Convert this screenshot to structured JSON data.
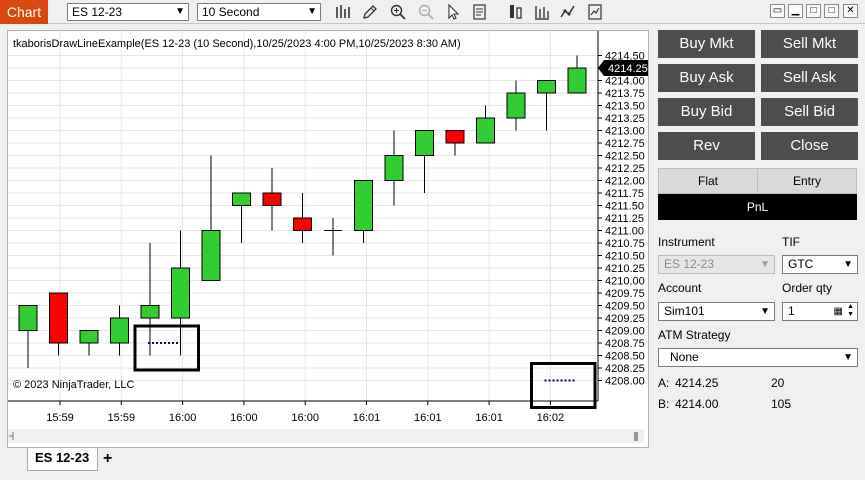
{
  "app": {
    "tag": "Chart"
  },
  "toolbar": {
    "instrument": "ES 12-23",
    "interval": "10 Second",
    "icons": [
      "bar-type-icon",
      "draw-pencil-icon",
      "zoom-in-icon",
      "zoom-out-icon",
      "pointer-icon",
      "properties-icon",
      "chart-trader-icon",
      "data-box-icon",
      "indicators-icon",
      "strategies-icon"
    ]
  },
  "window_controls": [
    "restore-icon",
    "minimize-icon",
    "maximize-icon",
    "close-icon"
  ],
  "chart": {
    "title": "tkaborisDrawLineExample(ES 12-23 (10 Second),10/25/2023 4:00 PM,10/25/2023 8:30 AM)",
    "copyright": "© 2023 NinjaTrader, LLC",
    "last_price_label": "4214.25",
    "colors": {
      "up": "#32cd32",
      "down": "#ff0000",
      "grid": "#e6e6e6",
      "marker": "#000080",
      "price_badge": "#000000"
    }
  },
  "chart_data": {
    "type": "candlestick",
    "y_ticks": [
      "4214.50",
      "4214.25",
      "4214.00",
      "4213.75",
      "4213.50",
      "4213.25",
      "4213.00",
      "4212.75",
      "4212.50",
      "4212.25",
      "4212.00",
      "4211.75",
      "4211.50",
      "4211.25",
      "4211.00",
      "4210.75",
      "4210.50",
      "4210.25",
      "4210.00",
      "4209.75",
      "4209.50",
      "4209.25",
      "4209.00",
      "4208.75",
      "4208.50",
      "4208.25",
      "4208.00"
    ],
    "ylim": [
      4207.75,
      4214.75
    ],
    "x_ticks": [
      "15:59",
      "15:59",
      "16:00",
      "16:00",
      "16:00",
      "16:01",
      "16:01",
      "16:01",
      "16:02"
    ],
    "candles": [
      {
        "o": 4209.0,
        "h": 4209.5,
        "l": 4208.25,
        "c": 4209.5
      },
      {
        "o": 4209.75,
        "h": 4209.75,
        "l": 4208.5,
        "c": 4208.75
      },
      {
        "o": 4208.75,
        "h": 4209.0,
        "l": 4208.5,
        "c": 4209.0
      },
      {
        "o": 4208.75,
        "h": 4209.5,
        "l": 4208.5,
        "c": 4209.25
      },
      {
        "o": 4209.25,
        "h": 4210.75,
        "l": 4208.5,
        "c": 4209.5
      },
      {
        "o": 4209.25,
        "h": 4211.0,
        "l": 4208.5,
        "c": 4210.25
      },
      {
        "o": 4210.0,
        "h": 4212.5,
        "l": 4210.0,
        "c": 4211.0
      },
      {
        "o": 4211.5,
        "h": 4211.75,
        "l": 4210.75,
        "c": 4211.75
      },
      {
        "o": 4211.75,
        "h": 4212.25,
        "l": 4211.0,
        "c": 4211.5
      },
      {
        "o": 4211.25,
        "h": 4211.75,
        "l": 4210.75,
        "c": 4211.0
      },
      {
        "o": 4211.0,
        "h": 4211.25,
        "l": 4210.5,
        "c": 4211.0
      },
      {
        "o": 4211.0,
        "h": 4212.0,
        "l": 4210.75,
        "c": 4212.0
      },
      {
        "o": 4212.0,
        "h": 4213.0,
        "l": 4211.5,
        "c": 4212.5
      },
      {
        "o": 4212.5,
        "h": 4213.0,
        "l": 4211.75,
        "c": 4213.0
      },
      {
        "o": 4213.0,
        "h": 4213.0,
        "l": 4212.5,
        "c": 4212.75
      },
      {
        "o": 4212.75,
        "h": 4213.5,
        "l": 4212.75,
        "c": 4213.25
      },
      {
        "o": 4213.25,
        "h": 4214.0,
        "l": 4213.0,
        "c": 4213.75
      },
      {
        "o": 4213.75,
        "h": 4214.0,
        "l": 4213.0,
        "c": 4214.0
      },
      {
        "o": 4213.75,
        "h": 4214.5,
        "l": 4213.75,
        "c": 4214.25
      }
    ],
    "marker_lines": [
      {
        "price": 4208.75,
        "candle_from": 4,
        "candle_to": 5
      },
      {
        "price": 4208.0,
        "candle_from": 17,
        "candle_to": 18
      }
    ]
  },
  "trader": {
    "buttons": [
      {
        "id": "buy-mkt",
        "label": "Buy Mkt"
      },
      {
        "id": "sell-mkt",
        "label": "Sell Mkt"
      },
      {
        "id": "buy-ask",
        "label": "Buy Ask"
      },
      {
        "id": "sell-ask",
        "label": "Sell Ask"
      },
      {
        "id": "buy-bid",
        "label": "Buy Bid"
      },
      {
        "id": "sell-bid",
        "label": "Sell Bid"
      },
      {
        "id": "rev",
        "label": "Rev"
      },
      {
        "id": "close",
        "label": "Close"
      }
    ],
    "position": "Flat",
    "entry": "Entry",
    "pnl": "PnL",
    "instrument_label": "Instrument",
    "instrument_value": "ES 12-23",
    "tif_label": "TIF",
    "tif_value": "GTC",
    "account_label": "Account",
    "account_value": "Sim101",
    "order_qty_label": "Order qty",
    "order_qty_value": "1",
    "atm_label": "ATM Strategy",
    "atm_value": "None",
    "ask_label": "A:",
    "ask_price": "4214.25",
    "ask_size": "20",
    "bid_label": "B:",
    "bid_price": "4214.00",
    "bid_size": "105"
  },
  "tabs": {
    "active": "ES 12-23",
    "add": "+"
  }
}
